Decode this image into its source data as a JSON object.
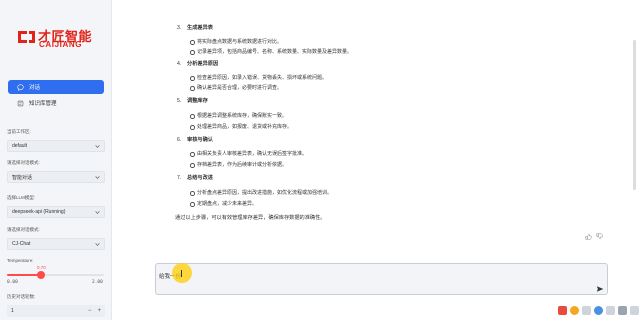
{
  "brand": {
    "name_cn": "才匠智能",
    "name_en": "CAIJIANG",
    "color": "#e2231a"
  },
  "nav": [
    {
      "label": "对话",
      "icon": "chat-bubble-icon",
      "active": true
    },
    {
      "label": "知识库管理",
      "icon": "database-icon",
      "active": false
    }
  ],
  "sidebar_form": {
    "mode_label": "当前工作区:",
    "mode_value": "default",
    "chat_mode_label": "请选择对话模式:",
    "chat_mode_value": "智能对话",
    "llm_label": "选择LLM模型:",
    "llm_value": "deepseek-api (Running)",
    "template_label": "请选择对话模式:",
    "template_value": "CJ-Chat",
    "temperature_label": "Temperature:",
    "temperature_value": "0.70",
    "temperature_min": "0.00",
    "temperature_max": "2.00",
    "temperature": 0.35,
    "history_label": "历史对话轮数:",
    "history_value": "1",
    "history_minus": "−",
    "history_plus": "+"
  },
  "message": {
    "sections": [
      {
        "num": "3.",
        "title": "生成差异表",
        "bullets": [
          "将实际盘点数据与系统数据进行对比。",
          "记录差异项，包括商品编号、名称、系统数量、实际数量及差异数量。"
        ]
      },
      {
        "num": "4.",
        "title": "分析差异原因",
        "bullets": [
          "检查差异原因，如录入错误、货物丢失、损坏或系统问题。",
          "确认差异是否合理，必要时进行调查。"
        ]
      },
      {
        "num": "5.",
        "title": "调整库存",
        "bullets": [
          "根据差异调整系统库存，确保账实一致。",
          "处理差异商品，如报废、退货或补充库存。"
        ]
      },
      {
        "num": "6.",
        "title": "审核与确认",
        "bullets": [
          "由相关负责人审核差异表，确认无误后签字批准。",
          "存档差异表，作为后续审计或分析依据。"
        ]
      },
      {
        "num": "7.",
        "title": "总结与改进",
        "bullets": [
          "分析盘点差异原因，提出改进措施，如优化流程或加强培训。",
          "定期盘点，减少未来差异。"
        ]
      }
    ],
    "summary": "通过以上步骤，可以有效管理库存差异，确保库存数据的准确性。"
  },
  "feedback": {
    "like_icon": "thumbs-up-icon",
    "dislike_icon": "thumbs-down-icon"
  },
  "chat_input": {
    "value": "给我一份",
    "send_icon": "send-icon"
  },
  "colors": {
    "accent": "#2f6fef",
    "slider": "#ff4b4b",
    "cursor": "#ffcd00"
  }
}
